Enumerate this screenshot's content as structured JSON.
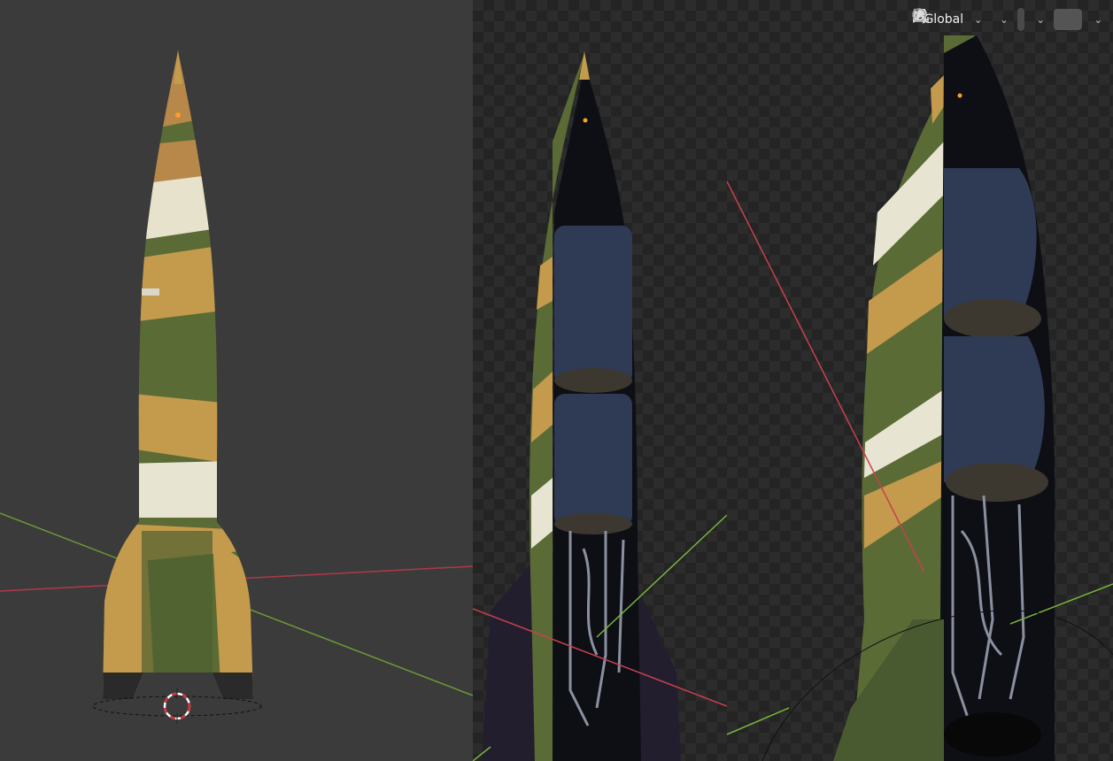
{
  "header": {
    "transform_orientation": "Global",
    "icons": [
      "transform-orientation-icon",
      "pivot-link-icon",
      "snap-magnet-icon",
      "snap-increment-icon",
      "proportional-edit-icon",
      "falloff-curve-icon"
    ]
  },
  "colors": {
    "viewport_bg": "#3b3b3b",
    "x_axis": "#c8414f",
    "y_axis": "#7ab43c",
    "cursor_red": "#d0303a",
    "camo_green": "#5a6b36",
    "camo_tan": "#c49a4c",
    "camo_white": "#e8e4d2",
    "tank_blue": "#2f3a55"
  }
}
